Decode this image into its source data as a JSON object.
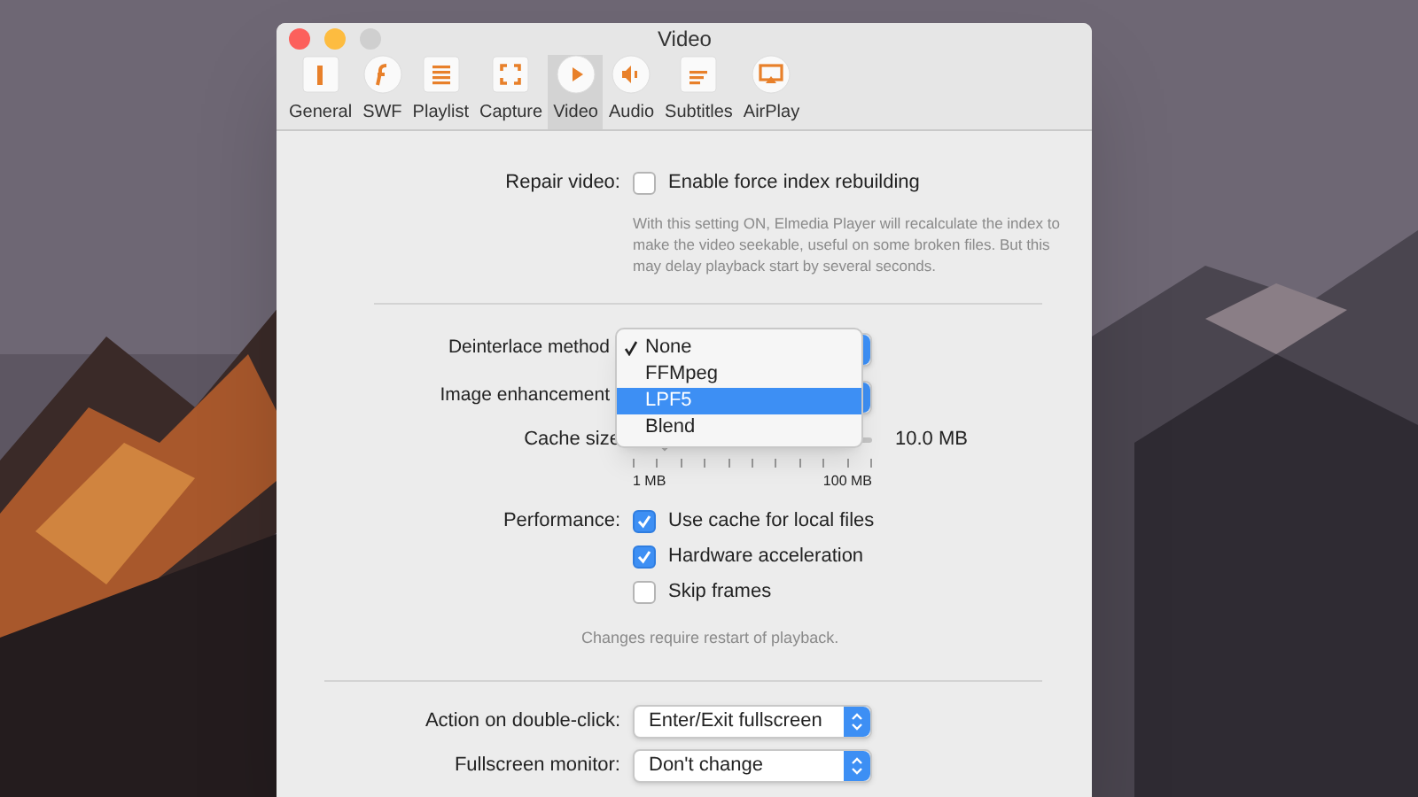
{
  "window": {
    "title": "Video"
  },
  "toolbar": [
    {
      "label": "General",
      "selected": false,
      "kind": "general"
    },
    {
      "label": "SWF",
      "selected": false,
      "kind": "swf"
    },
    {
      "label": "Playlist",
      "selected": false,
      "kind": "playlist"
    },
    {
      "label": "Capture",
      "selected": false,
      "kind": "capture"
    },
    {
      "label": "Video",
      "selected": true,
      "kind": "video"
    },
    {
      "label": "Audio",
      "selected": false,
      "kind": "audio"
    },
    {
      "label": "Subtitles",
      "selected": false,
      "kind": "subtitles"
    },
    {
      "label": "AirPlay",
      "selected": false,
      "kind": "airplay"
    }
  ],
  "repair": {
    "label": "Repair video:",
    "option": {
      "label": "Enable force index rebuilding",
      "checked": false
    },
    "note": "With this setting ON, Elmedia Player will recalculate the index to make the video seekable, useful on some broken files. But this may delay playback start by several seconds."
  },
  "deinterlace": {
    "label": "Deinterlace method"
  },
  "image_enhancement": {
    "label": "Image enhancement"
  },
  "popup_menu": {
    "items": [
      {
        "label": "None",
        "checked": true,
        "selected": false
      },
      {
        "label": "FFMpeg",
        "checked": false,
        "selected": false
      },
      {
        "label": "LPF5",
        "checked": false,
        "selected": true
      },
      {
        "label": "Blend",
        "checked": false,
        "selected": false
      }
    ]
  },
  "cache": {
    "label": "Cache size",
    "level": 0.13,
    "reading": "10.0 MB",
    "min_label": "1 MB",
    "max_label": "100 MB"
  },
  "performance": {
    "label": "Performance:",
    "options": [
      {
        "label": "Use cache for local files",
        "checked": true
      },
      {
        "label": "Hardware acceleration",
        "checked": true
      },
      {
        "label": "Skip frames",
        "checked": false
      }
    ],
    "note": "Changes require restart of playback."
  },
  "action": {
    "label": "Action on double-click:",
    "value": "Enter/Exit fullscreen"
  },
  "fullscreen": {
    "label": "Fullscreen monitor:",
    "value": "Don't change"
  }
}
